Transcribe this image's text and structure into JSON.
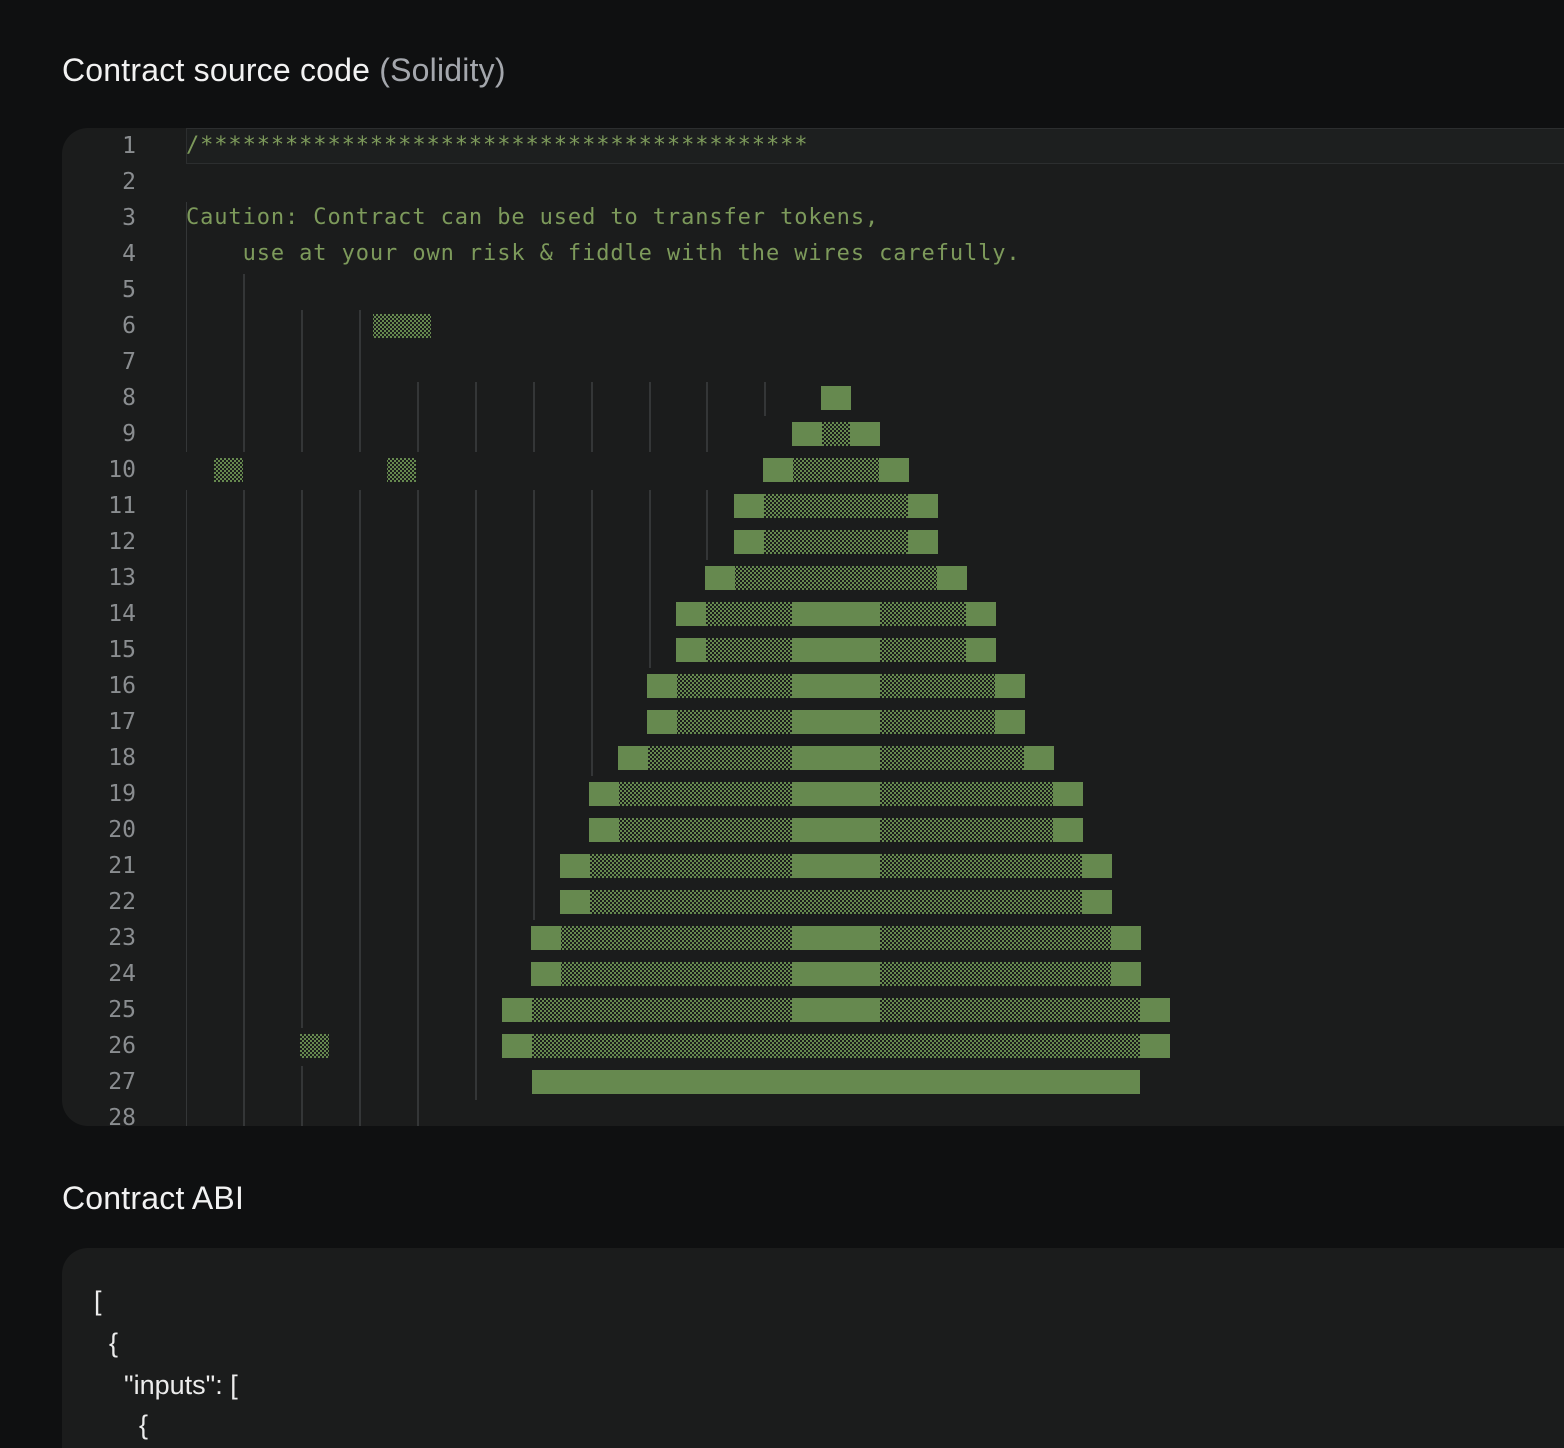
{
  "source_section": {
    "title": "Contract source code",
    "language": "(Solidity)"
  },
  "code": {
    "line_numbers": [
      "1",
      "2",
      "3",
      "4",
      "5",
      "6",
      "7",
      "8",
      "9",
      "10",
      "11",
      "12",
      "13",
      "14",
      "15",
      "16",
      "17",
      "18",
      "19",
      "20",
      "21",
      "22",
      "23",
      "24",
      "25",
      "26",
      "27",
      "28"
    ],
    "line1": "/*******************************************",
    "line3": "Caution: Contract can be used to transfer tokens,",
    "line4": "    use at your own risk & fiddle with the wires carefully.",
    "colors": {
      "comment": "#7d9a5b",
      "block": "#66894f",
      "guide": "#3d3f40"
    }
  },
  "abi_section": {
    "title": "Contract ABI",
    "lines": [
      "[",
      "  {",
      "    \"inputs\": [",
      "      {"
    ]
  }
}
